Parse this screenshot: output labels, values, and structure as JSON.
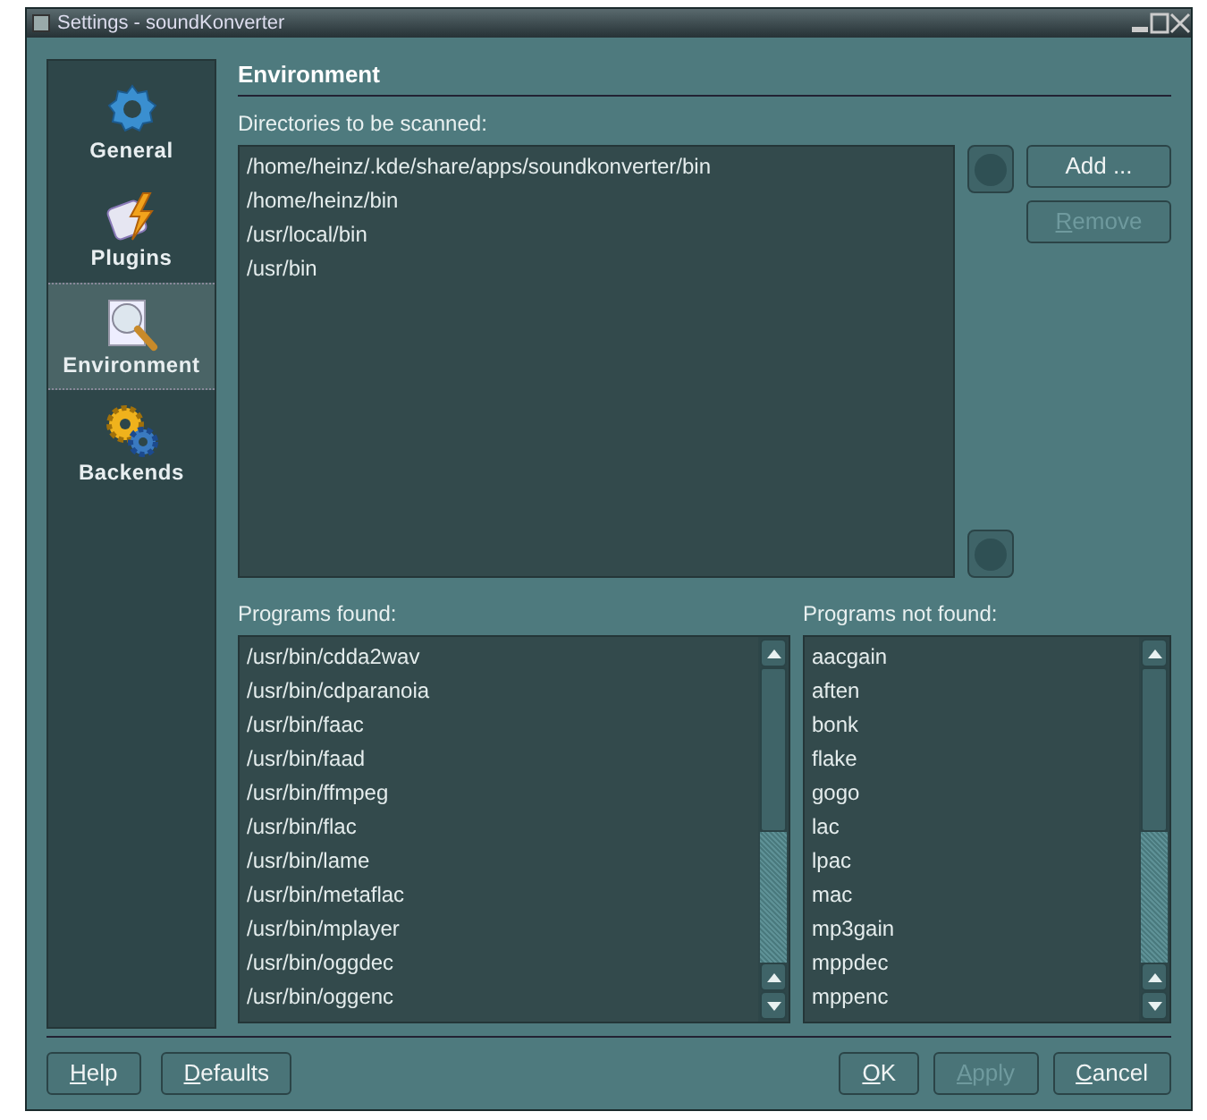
{
  "window": {
    "title": "Settings - soundKonverter"
  },
  "sidebar": {
    "items": [
      {
        "label": "General",
        "selected": false
      },
      {
        "label": "Plugins",
        "selected": false
      },
      {
        "label": "Environment",
        "selected": true
      },
      {
        "label": "Backends",
        "selected": false
      }
    ]
  },
  "page": {
    "title": "Environment",
    "directories_label": "Directories to be scanned:",
    "directories": [
      "/home/heinz/.kde/share/apps/soundkonverter/bin",
      "/home/heinz/bin",
      "/usr/local/bin",
      "/usr/bin"
    ],
    "side_buttons": [
      {
        "label": "Add ...",
        "disabled": false,
        "mnemonic": false
      },
      {
        "label": "Remove",
        "disabled": true,
        "mnemonic": true
      }
    ],
    "found_label": "Programs found:",
    "found": [
      "/usr/bin/cdda2wav",
      "/usr/bin/cdparanoia",
      "/usr/bin/faac",
      "/usr/bin/faad",
      "/usr/bin/ffmpeg",
      "/usr/bin/flac",
      "/usr/bin/lame",
      "/usr/bin/metaflac",
      "/usr/bin/mplayer",
      "/usr/bin/oggdec",
      "/usr/bin/oggenc"
    ],
    "not_found_label": "Programs not found:",
    "not_found": [
      "aacgain",
      "aften",
      "bonk",
      "flake",
      "gogo",
      "lac",
      "lpac",
      "mac",
      "mp3gain",
      "mppdec",
      "mppenc"
    ]
  },
  "buttons_left": [
    {
      "label": "Help",
      "disabled": false,
      "mnemonic": true
    },
    {
      "label": "Defaults",
      "disabled": false,
      "mnemonic": true
    }
  ],
  "buttons_right": [
    {
      "label": "OK",
      "disabled": false,
      "mnemonic": true
    },
    {
      "label": "Apply",
      "disabled": true,
      "mnemonic": true
    },
    {
      "label": "Cancel",
      "disabled": false,
      "mnemonic": true
    }
  ]
}
